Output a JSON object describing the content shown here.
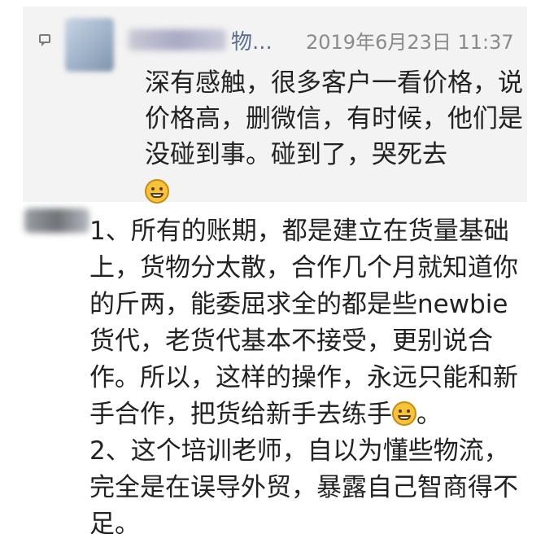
{
  "top_comment": {
    "author_visible": "物...",
    "timestamp": "2019年6月23日 11:37",
    "text": "深有感触，很多客户一看价格，说价格高，删微信，有时候，他们是没碰到事。碰到了，哭死去",
    "emoji": "grinning-face"
  },
  "bottom_comment": {
    "text_1": "1、所有的账期，都是建立在货量基础上，货物分太散，合作几个月就知道你的斤两，能委屈求全的都是些newbie货代，老货代基本不接受，更别说合作。所以，这样的操作，永远只能和新手合作，把货给新手去练手",
    "text_1_end": "。",
    "emoji": "smiling-face",
    "text_2": "2、这个培训老师，自以为懂些物流，完全是在误导外贸，暴露自己智商得不足。"
  }
}
